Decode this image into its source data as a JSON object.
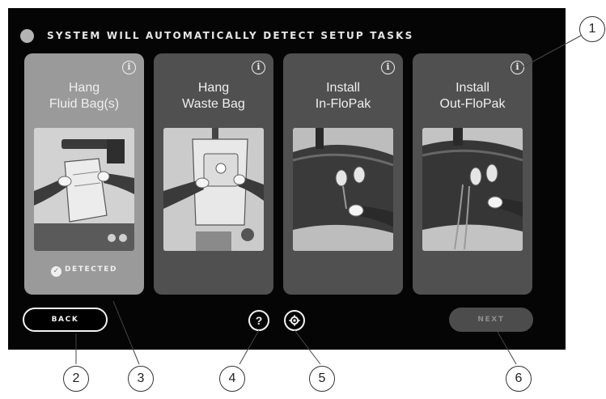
{
  "header": {
    "text": "SYSTEM WILL AUTOMATICALLY DETECT SETUP TASKS"
  },
  "cards": [
    {
      "title_line1": "Hang",
      "title_line2": "Fluid Bag(s)",
      "status": "DETECTED",
      "info_icon": "info-icon"
    },
    {
      "title_line1": "Hang",
      "title_line2": "Waste Bag",
      "info_icon": "info-icon"
    },
    {
      "title_line1": "Install",
      "title_line2": "In-FloPak",
      "info_icon": "info-icon"
    },
    {
      "title_line1": "Install",
      "title_line2": "Out-FloPak",
      "info_icon": "info-icon"
    }
  ],
  "footer": {
    "back_label": "BACK",
    "help_icon": "?",
    "settings_icon": "gear-icon",
    "next_label": "NEXT"
  },
  "callouts": [
    "1",
    "2",
    "3",
    "4",
    "5",
    "6"
  ],
  "colors": {
    "screen_bg": "#050505",
    "card_bg": "#505050",
    "card_detected_bg": "#9a9a9a",
    "next_disabled": "#4c4c4c"
  }
}
